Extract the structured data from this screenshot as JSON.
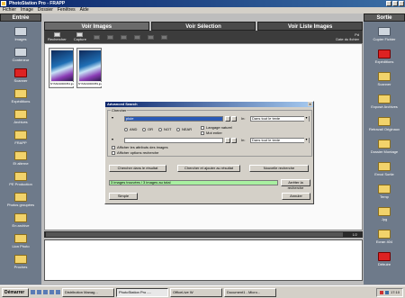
{
  "window": {
    "title": "PhotoStation Pro - FRAPP"
  },
  "menu": [
    "Fichier",
    "Image",
    "Dossier",
    "Fenêtres",
    "Aide"
  ],
  "left_panel": {
    "header": "Entrée",
    "items": [
      {
        "label": "Images",
        "icon": "image-icon",
        "kind": "tool"
      },
      {
        "label": "Conteneur",
        "icon": "container-icon",
        "kind": "tool"
      },
      {
        "label": "Scanner",
        "icon": "scanner-icon",
        "kind": "red"
      },
      {
        "label": "Expéditions",
        "icon": "folder-icon",
        "kind": "folder"
      },
      {
        "label": "Archives",
        "icon": "folder-icon",
        "kind": "folder"
      },
      {
        "label": "FRAPP",
        "icon": "folder-icon",
        "kind": "folder"
      },
      {
        "label": "Et alterne",
        "icon": "folder-icon",
        "kind": "folder"
      },
      {
        "label": "PE Production",
        "icon": "folder-icon",
        "kind": "folder"
      },
      {
        "label": "Photos groupées",
        "icon": "folder-icon",
        "kind": "folder"
      },
      {
        "label": "En archive",
        "icon": "folder-icon",
        "kind": "folder"
      },
      {
        "label": "Lion Photo",
        "icon": "folder-icon",
        "kind": "folder"
      },
      {
        "label": "Proches",
        "icon": "folder-icon",
        "kind": "folder"
      }
    ]
  },
  "right_panel": {
    "header": "Sortie",
    "items": [
      {
        "label": "Copier Fichier",
        "icon": "copy-icon",
        "kind": "tool"
      },
      {
        "label": "Expéditions",
        "icon": "send-icon",
        "kind": "red"
      },
      {
        "label": "Scanner",
        "icon": "folder-icon",
        "kind": "folder"
      },
      {
        "label": "Exposé Archives",
        "icon": "folder-icon",
        "kind": "folder"
      },
      {
        "label": "Retravail Originaux",
        "icon": "folder-icon",
        "kind": "folder"
      },
      {
        "label": "Dossier Montage",
        "icon": "folder-icon",
        "kind": "folder"
      },
      {
        "label": "Envoi Sortie",
        "icon": "folder-icon",
        "kind": "folder"
      },
      {
        "label": "Temp",
        "icon": "folder-icon",
        "kind": "folder"
      },
      {
        "label": "Jpg",
        "icon": "folder-icon",
        "kind": "folder"
      },
      {
        "label": "Ecran 404",
        "icon": "folder-icon",
        "kind": "folder"
      },
      {
        "label": "Détruire",
        "icon": "trash-icon",
        "kind": "red"
      }
    ]
  },
  "tabs": [
    {
      "label": "Voir Images",
      "active": true
    },
    {
      "label": "Voir Sélection",
      "active": false
    },
    {
      "label": "Voir Liste Images",
      "active": false
    }
  ],
  "toolbar": {
    "buttons": [
      {
        "label": "Rechercher",
        "enabled": true
      },
      {
        "label": "Capture",
        "enabled": true
      },
      {
        "label": "",
        "enabled": false
      },
      {
        "label": "",
        "enabled": false
      },
      {
        "label": "",
        "enabled": false
      },
      {
        "label": "",
        "enabled": false
      },
      {
        "label": "",
        "enabled": false
      },
      {
        "label": "",
        "enabled": false
      }
    ],
    "zoom_text": "Pd",
    "date_text": "Date du fichier"
  },
  "thumbnails": [
    {
      "caption": "NYM3A0000354.jpg"
    },
    {
      "caption": "NYM3A0000359.jpg"
    }
  ],
  "scrollbar": {
    "count": "1/2"
  },
  "dialog": {
    "title": "Advanced Search",
    "group_label": "Chercher",
    "row1": {
      "value": "pluie",
      "prefix": "In:",
      "scope": "Dans tout le texte"
    },
    "operators": [
      "AND",
      "OR",
      "NOT",
      "NEAR"
    ],
    "language_label": "Langage naturel",
    "case_label": "Mot entier",
    "row2": {
      "prefix": "In:",
      "scope": "Dans tout le texte"
    },
    "option1": "Afficher les attributs des images",
    "option2": "Afficher options recherche",
    "buttons": [
      "Chercher dans le résultat",
      "Chercher et ajouter au résultat",
      "Nouvelle recherche"
    ],
    "status_text": "3 images trouvées / 3 images au total",
    "search_button": "Arrêter la recherche",
    "simple_button": "Simple",
    "cancel_button": "Annuler"
  },
  "taskbar": {
    "start": "Démarrer",
    "tasks": [
      "Distribution Manag...",
      "PhotoStation Pro -...",
      "OfficeLive W",
      "Document1 - Micro..."
    ],
    "active_task": 1,
    "time": "17:10"
  }
}
